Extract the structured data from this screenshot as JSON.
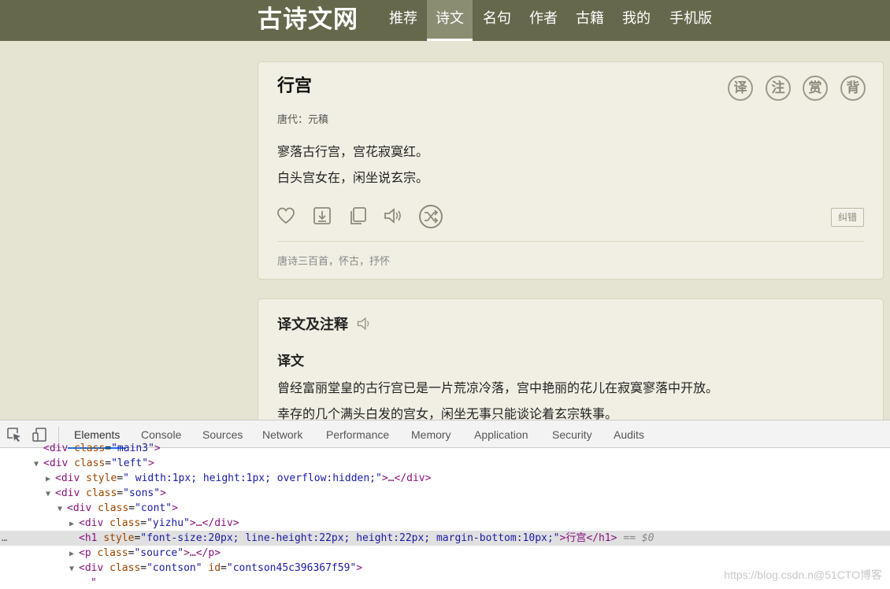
{
  "site": {
    "logo": "古诗文网",
    "nav": [
      "推荐",
      "诗文",
      "名句",
      "作者",
      "古籍",
      "我的",
      "手机版"
    ],
    "active_nav": "诗文"
  },
  "poem": {
    "title": "行宫",
    "meta": "唐代：元稹",
    "lines": [
      "寥落古行宫，宫花寂寞红。",
      "白头宫女在，闲坐说玄宗。"
    ],
    "side_buttons": [
      "译",
      "注",
      "赏",
      "背"
    ],
    "actions": [
      "heart-icon",
      "download-icon",
      "copy-icon",
      "speaker-icon",
      "shuffle-icon"
    ],
    "report_label": "纠错",
    "tags": "唐诗三百首，怀古，抒怀"
  },
  "translation": {
    "title": "译文及注释",
    "subtitle": "译文",
    "paragraphs": [
      "曾经富丽堂皇的古行宫已是一片荒凉冷落，宫中艳丽的花儿在寂寞寥落中开放。",
      "幸存的几个满头白发的宫女，闲坐无事只能谈论着玄宗轶事。"
    ]
  },
  "devtools": {
    "tabs": [
      "Elements",
      "Console",
      "Sources",
      "Network",
      "Performance",
      "Memory",
      "Application",
      "Security",
      "Audits"
    ],
    "active_tab": "Elements",
    "lines": [
      {
        "indent": 3,
        "tri": "",
        "tag": "<div ",
        "attr": "class",
        "val": "\"main3\"",
        "rest": ">"
      },
      {
        "indent": 3,
        "tri": "▼",
        "tag": "<div ",
        "attr": "class",
        "val": "\"left\"",
        "rest": ">"
      },
      {
        "indent": 4,
        "tri": "▶",
        "tag": "<div ",
        "attr": "style",
        "val": "\" width:1px; height:1px; overflow:hidden;\"",
        "rest": ">…</div>"
      },
      {
        "indent": 4,
        "tri": "▼",
        "tag": "<div ",
        "attr": "class",
        "val": "\"sons\"",
        "rest": ">"
      },
      {
        "indent": 5,
        "tri": "▼",
        "tag": "<div ",
        "attr": "class",
        "val": "\"cont\"",
        "rest": ">"
      },
      {
        "indent": 6,
        "tri": "▶",
        "tag": "<div ",
        "attr": "class",
        "val": "\"yizhu\"",
        "rest": ">…</div>"
      },
      {
        "indent": 6,
        "tri": "",
        "tag": "<h1 ",
        "attr": "style",
        "val": "\"font-size:20px; line-height:22px; height:22px; margin-bottom:10px;\"",
        "rest": ">行宫</h1>",
        "note": " == $0"
      },
      {
        "indent": 6,
        "tri": "▶",
        "tag": "<p ",
        "attr": "class",
        "val": "\"source\"",
        "rest": ">…</p>"
      },
      {
        "indent": 6,
        "tri": "▼",
        "tag": "<div ",
        "attr": "class",
        "val": "\"contson\"",
        "attr2": "id",
        "val2": "\"contson45c396367f59\"",
        "rest": ">"
      },
      {
        "indent": 7,
        "tri": "",
        "tag": "\"",
        "attr": "",
        "val": "",
        "rest": ""
      }
    ],
    "watermark": "https://blog.csdn.n@51CTO博客"
  }
}
